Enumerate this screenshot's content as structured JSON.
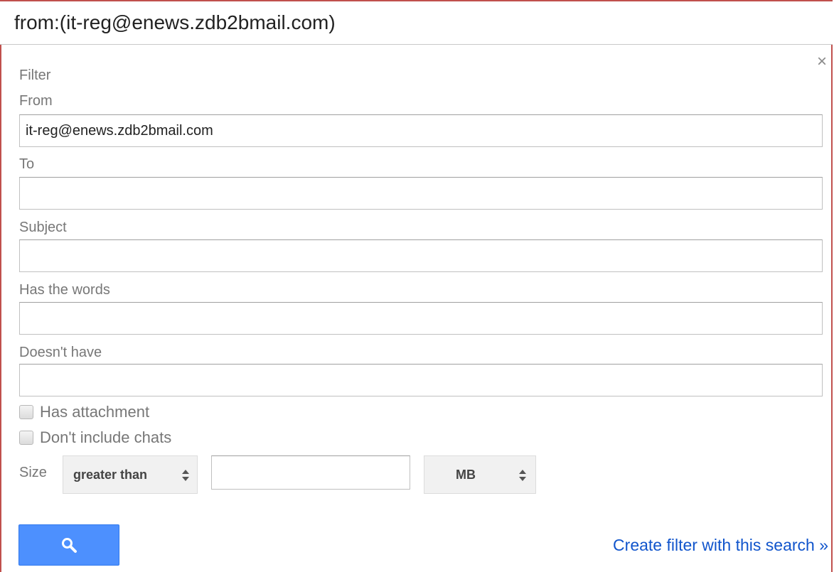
{
  "search": {
    "query": "from:(it-reg@enews.zdb2bmail.com)"
  },
  "filter": {
    "title": "Filter",
    "close_icon": "×",
    "from": {
      "label": "From",
      "value": "it-reg@enews.zdb2bmail.com"
    },
    "to": {
      "label": "To",
      "value": ""
    },
    "subject": {
      "label": "Subject",
      "value": ""
    },
    "has_words": {
      "label": "Has the words",
      "value": ""
    },
    "doesnt_have": {
      "label": "Doesn't have",
      "value": ""
    },
    "has_attachment": {
      "label": "Has attachment",
      "checked": false
    },
    "dont_include_chats": {
      "label": "Don't include chats",
      "checked": false
    },
    "size": {
      "label": "Size",
      "operator": "greater than",
      "value": "",
      "unit": "MB"
    },
    "search_button_icon": "search-icon",
    "create_filter_link": "Create filter with this search »"
  },
  "colors": {
    "frame_border": "#c0504d",
    "button_blue": "#4d90fe",
    "link_blue": "#1155cc",
    "label_gray": "#777777"
  }
}
